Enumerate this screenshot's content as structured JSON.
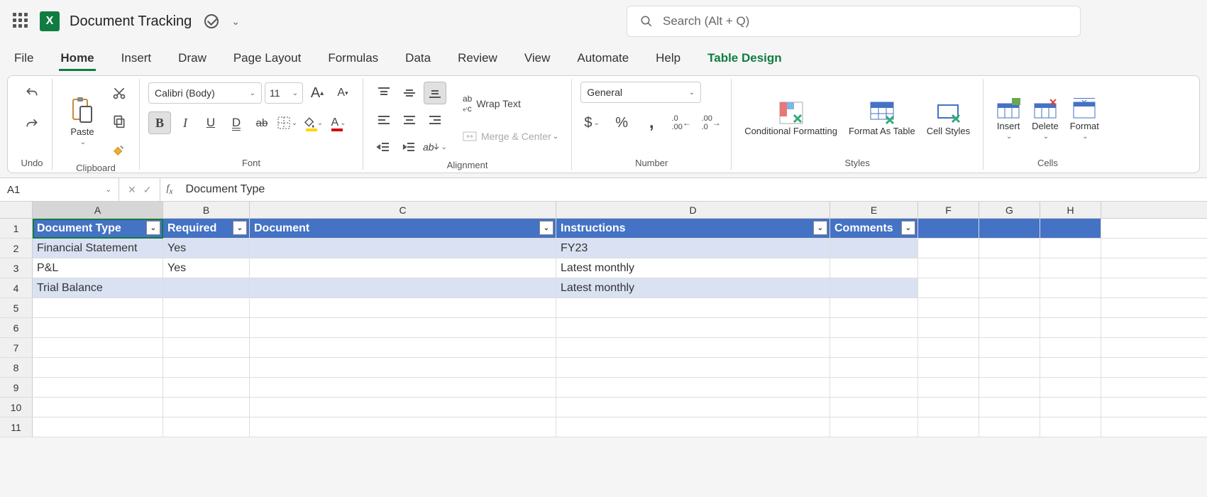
{
  "title": "Document Tracking",
  "search_placeholder": "Search (Alt + Q)",
  "tabs": [
    "File",
    "Home",
    "Insert",
    "Draw",
    "Page Layout",
    "Formulas",
    "Data",
    "Review",
    "View",
    "Automate",
    "Help",
    "Table Design"
  ],
  "active_tab": "Home",
  "ribbon": {
    "undo_label": "Undo",
    "clipboard_label": "Clipboard",
    "paste_label": "Paste",
    "font_label": "Font",
    "font_name": "Calibri (Body)",
    "font_size": "11",
    "alignment_label": "Alignment",
    "wrap_text": "Wrap Text",
    "merge_center": "Merge & Center",
    "number_label": "Number",
    "number_format": "General",
    "styles_label": "Styles",
    "cond_fmt": "Conditional Formatting",
    "fmt_table": "Format As Table",
    "cell_styles": "Cell Styles",
    "cells_label": "Cells",
    "insert": "Insert",
    "delete": "Delete",
    "format": "Format"
  },
  "namebox": "A1",
  "formula": "Document Type",
  "columns": [
    "A",
    "B",
    "C",
    "D",
    "E",
    "F",
    "G",
    "H"
  ],
  "table": {
    "headers": [
      "Document Type",
      "Required",
      "Document",
      "Instructions",
      "Comments"
    ],
    "rows": [
      {
        "A": "Financial Statement",
        "B": "Yes",
        "C": "",
        "D": "FY23",
        "E": ""
      },
      {
        "A": "P&L",
        "B": "Yes",
        "C": "",
        "D": "Latest monthly",
        "E": ""
      },
      {
        "A": "Trial Balance",
        "B": "",
        "C": "",
        "D": "Latest monthly",
        "E": ""
      }
    ]
  }
}
